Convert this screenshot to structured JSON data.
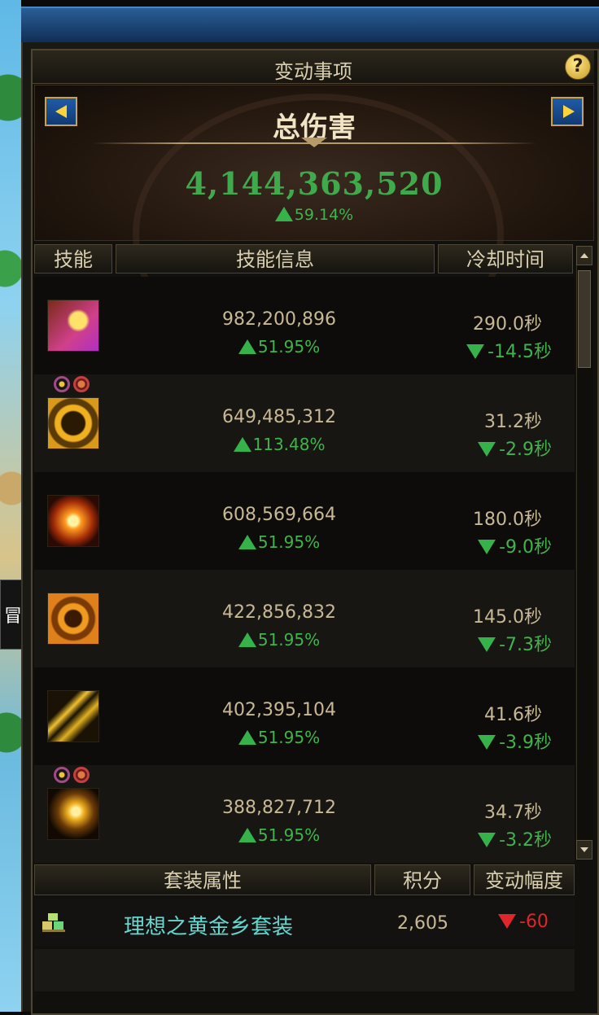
{
  "panel": {
    "title": "变动事项",
    "help_icon": "question-mark-icon"
  },
  "summary": {
    "label": "总伤害",
    "value": "4,144,363,520",
    "delta": "59.14%",
    "delta_direction": "up"
  },
  "skill_table": {
    "headers": [
      "技能",
      "技能信息",
      "冷却时间"
    ],
    "rows": [
      {
        "damage": "982,200,896",
        "damage_delta": "51.95%",
        "cooldown": "290.0秒",
        "cooldown_delta": "-14.5秒",
        "tags": []
      },
      {
        "damage": "649,485,312",
        "damage_delta": "113.48%",
        "cooldown": "31.2秒",
        "cooldown_delta": "-2.9秒",
        "tags": [
          "rune-tag-icon",
          "gear-tag-icon"
        ]
      },
      {
        "damage": "608,569,664",
        "damage_delta": "51.95%",
        "cooldown": "180.0秒",
        "cooldown_delta": "-9.0秒",
        "tags": []
      },
      {
        "damage": "422,856,832",
        "damage_delta": "51.95%",
        "cooldown": "145.0秒",
        "cooldown_delta": "-7.3秒",
        "tags": []
      },
      {
        "damage": "402,395,104",
        "damage_delta": "51.95%",
        "cooldown": "41.6秒",
        "cooldown_delta": "-3.9秒",
        "tags": []
      },
      {
        "damage": "388,827,712",
        "damage_delta": "51.95%",
        "cooldown": "34.7秒",
        "cooldown_delta": "-3.2秒",
        "tags": [
          "rune-tag-icon",
          "gear-tag-icon"
        ]
      }
    ]
  },
  "set_table": {
    "headers": [
      "套装属性",
      "积分",
      "变动幅度"
    ],
    "rows": [
      {
        "name": "理想之黄金乡套装",
        "score": "2,605",
        "change": "-60",
        "change_direction": "down"
      }
    ]
  },
  "side_tab": {
    "label": "冒"
  },
  "colors": {
    "positive": "#41b34d",
    "negative": "#e0262a",
    "set_name": "#63d8d0",
    "header_text": "#d9cfb0"
  }
}
